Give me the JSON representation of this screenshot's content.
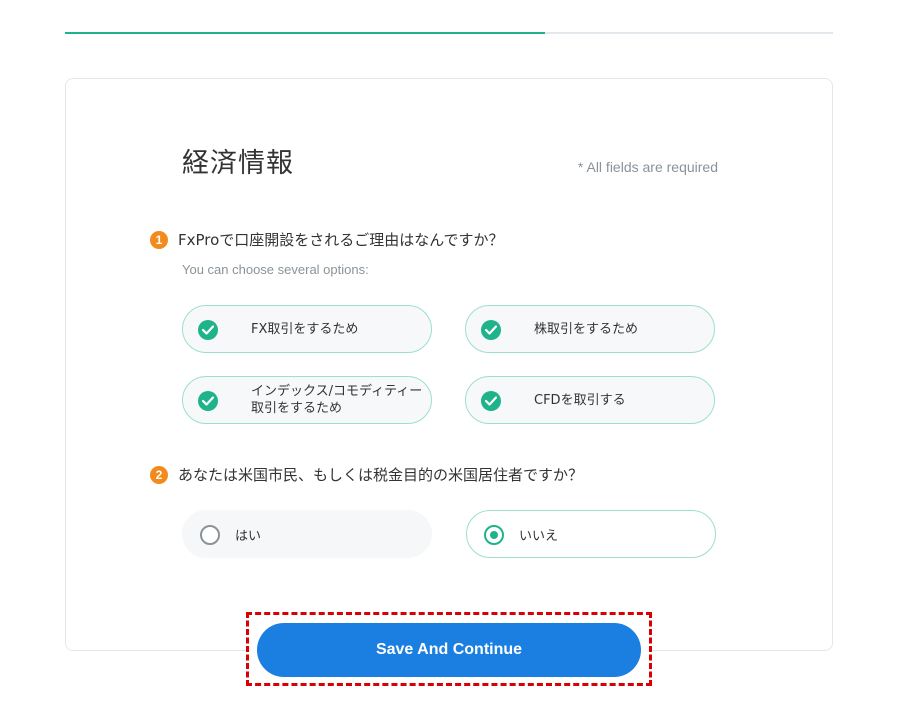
{
  "progress": {
    "fraction": 0.625
  },
  "form": {
    "title": "経済情報",
    "required_note": "* All fields are required",
    "question1": {
      "number": "1",
      "text": "FxProで口座開設をされるご理由はなんですか？",
      "hint": "You can choose several options:",
      "options": [
        {
          "label": "FX取引をするため",
          "checked": true
        },
        {
          "label": "株取引をするため",
          "checked": true
        },
        {
          "label_line1": "インデックス/コモディティー",
          "label_line2": "取引をするため",
          "checked": true
        },
        {
          "label": "CFDを取引する",
          "checked": true
        }
      ]
    },
    "question2": {
      "number": "2",
      "text": "あなたは米国市民、もしくは税金目的の米国居住者ですか？",
      "options": [
        {
          "label": "はい",
          "selected": false
        },
        {
          "label": "いいえ",
          "selected": true
        }
      ]
    }
  },
  "actions": {
    "save_label": "Save And Continue"
  },
  "colors": {
    "accent": "#1fb38b",
    "primary": "#1a7fe0",
    "badge": "#f28b1c",
    "highlight": "#d80000"
  },
  "icons": {
    "checked": "check-circle-icon",
    "radio_on": "radio-selected-icon",
    "radio_off": "radio-unselected-icon"
  }
}
